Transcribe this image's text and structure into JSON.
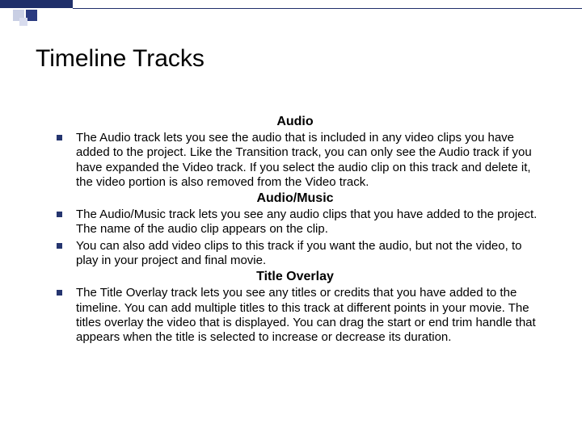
{
  "slide": {
    "title": "Timeline Tracks",
    "sections": [
      {
        "heading": "Audio",
        "bullets": [
          "The Audio track lets you see the audio that is included in any video clips you have added to the project. Like the Transition track, you can only see the Audio track if you have expanded the Video track. If you select the audio clip on this track and delete it, the video portion is also removed from the Video track."
        ]
      },
      {
        "heading": "Audio/Music",
        "bullets": [
          "The Audio/Music track lets you see any audio clips that you have added to the project. The name of the audio clip appears on the clip.",
          "You can also add video clips to this track if you want the audio, but not the video, to play in your project and final movie."
        ]
      },
      {
        "heading": "Title Overlay",
        "bullets": [
          "The Title Overlay track lets you see any titles or credits that you have added to the timeline. You can add multiple titles to this track at different points in your movie. The titles overlay the video that is displayed. You can drag the start or end trim handle that appears when the title is selected to increase or decrease its duration."
        ]
      }
    ]
  }
}
